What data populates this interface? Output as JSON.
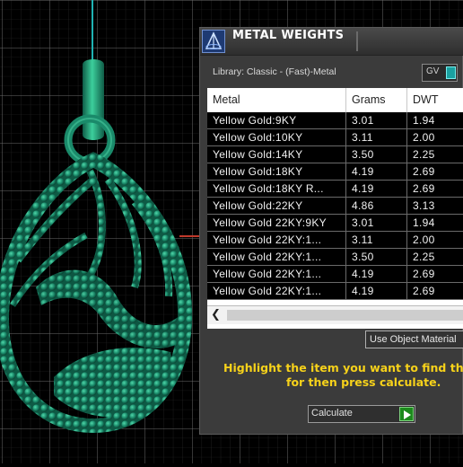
{
  "window": {
    "title": "METAL WEIGHTS",
    "app_icon": "metal-weights-app-icon"
  },
  "library": {
    "label": "Library: Classic - (Fast)-Metal",
    "gv_label": "GV"
  },
  "table": {
    "columns": [
      "Metal",
      "Grams",
      "DWT"
    ],
    "rows": [
      [
        "Yellow Gold:9KY",
        "3.01",
        "1.94"
      ],
      [
        "Yellow Gold:10KY",
        "3.11",
        "2.00"
      ],
      [
        "Yellow Gold:14KY",
        "3.50",
        "2.25"
      ],
      [
        "Yellow Gold:18KY",
        "4.19",
        "2.69"
      ],
      [
        "Yellow Gold:18KY R...",
        "4.19",
        "2.69"
      ],
      [
        "Yellow Gold:22KY",
        "4.86",
        "3.13"
      ],
      [
        "Yellow Gold 22KY:9KY",
        "3.01",
        "1.94"
      ],
      [
        "Yellow Gold 22KY:1...",
        "3.11",
        "2.00"
      ],
      [
        "Yellow Gold 22KY:1...",
        "3.50",
        "2.25"
      ],
      [
        "Yellow Gold 22KY:1...",
        "4.19",
        "2.69"
      ],
      [
        "Yellow Gold 22KY:1...",
        "4.19",
        "2.69"
      ]
    ]
  },
  "buttons": {
    "use_object_material": "Use Object Material",
    "calculate": "Calculate"
  },
  "instructions": {
    "line1": "Highlight the item you want to find the w",
    "line2": "for then press calculate."
  },
  "colors": {
    "viewport_bg": "#000000",
    "grid": "#5a5a5a",
    "model": "#1a8a6a",
    "instruction": "#f7d21a",
    "panel_bg": "#3b3b3b",
    "accent_axis_red": "#c0392b",
    "accent_axis_cyan": "#1fb3b3"
  }
}
